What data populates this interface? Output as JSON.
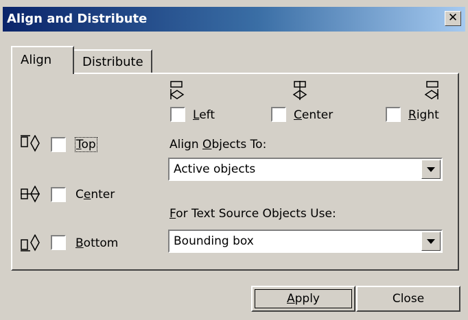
{
  "window": {
    "title": "Align and Distribute",
    "close_glyph": "✕"
  },
  "tabs": [
    {
      "label": "Align",
      "active": true
    },
    {
      "label": "Distribute",
      "active": false
    }
  ],
  "horizontal_align": [
    {
      "label": "Left",
      "hotkey": "L",
      "rest": "eft",
      "checked": false,
      "icon": "align-left-icon"
    },
    {
      "label": "Center",
      "hotkey": "C",
      "rest": "enter",
      "checked": false,
      "icon": "align-hcenter-icon"
    },
    {
      "label": "Right",
      "hotkey": "R",
      "rest": "ight",
      "checked": false,
      "icon": "align-right-icon"
    }
  ],
  "vertical_align": [
    {
      "label": "Top",
      "hotkey": "T",
      "rest": "op",
      "checked": false,
      "icon": "align-top-icon"
    },
    {
      "label": "Center",
      "pre": "C",
      "hotkey": "e",
      "rest": "nter",
      "checked": false,
      "icon": "align-vcenter-icon"
    },
    {
      "label": "Bottom",
      "hotkey": "B",
      "rest": "ottom",
      "checked": false,
      "icon": "align-bottom-icon"
    }
  ],
  "align_to": {
    "label_pre": "Align ",
    "label_hotkey": "O",
    "label_rest": "bjects To:",
    "value": "Active objects"
  },
  "text_source": {
    "label_hotkey": "F",
    "label_rest": "or Text Source Objects Use:",
    "value": "Bounding box"
  },
  "buttons": {
    "apply": {
      "hotkey": "A",
      "rest": "pply"
    },
    "close": {
      "label": "Close"
    }
  }
}
